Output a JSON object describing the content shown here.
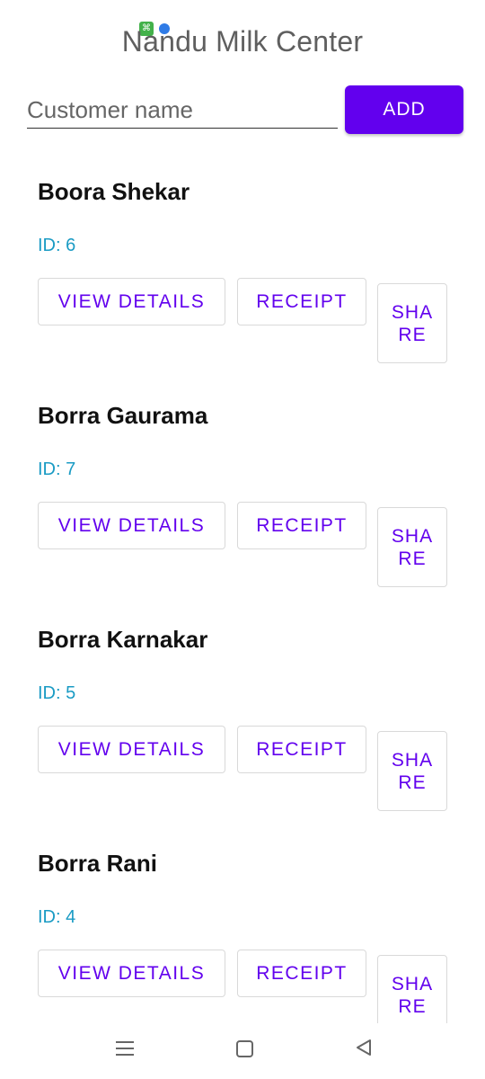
{
  "header": {
    "title": "Nandu Milk Center"
  },
  "form": {
    "placeholder": "Customer name",
    "add_label": "ADD"
  },
  "customers": [
    {
      "name": "Boora Shekar",
      "id": "ID: 6"
    },
    {
      "name": "Borra Gaurama",
      "id": "ID: 7"
    },
    {
      "name": "Borra Karnakar",
      "id": "ID: 5"
    },
    {
      "name": "Borra Rani",
      "id": "ID: 4"
    }
  ],
  "actions": {
    "view": "VIEW DETAILS",
    "receipt": "RECEIPT",
    "share": "SHARE"
  },
  "colors": {
    "accent": "#6200ee",
    "id_text": "#1a9bc4"
  }
}
